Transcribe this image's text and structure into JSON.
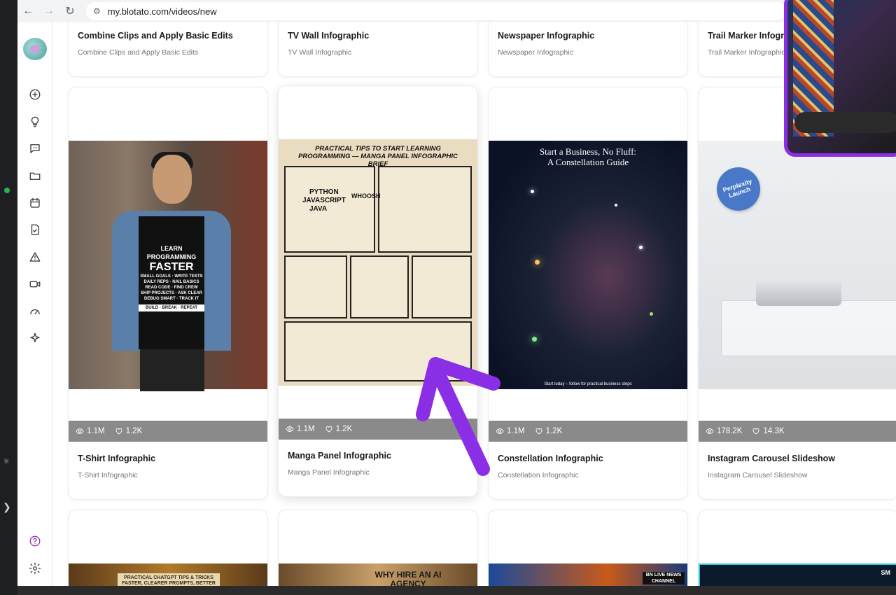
{
  "browser": {
    "url": "my.blotato.com/videos/new"
  },
  "cards_top": [
    {
      "title": "Combine Clips and Apply Basic Edits",
      "subtitle": "Combine Clips and Apply Basic Edits"
    },
    {
      "title": "TV Wall Infographic",
      "subtitle": "TV Wall Infographic"
    },
    {
      "title": "Newspaper Infographic",
      "subtitle": "Newspaper Infographic"
    },
    {
      "title": "Trail Marker Infogra",
      "subtitle": "Trail Marker Infographic"
    }
  ],
  "cards_main": [
    {
      "title": "T-Shirt Infographic",
      "subtitle": "T-Shirt Infographic",
      "views": "1.1M",
      "likes": "1.2K",
      "art": {
        "lines": [
          "LEARN PROGRAMMING",
          "FASTER",
          "SMALL GOALS",
          "WRITE TESTS",
          "DAILY REPS",
          "NAIL BASICS",
          "READ CODE",
          "FIND CREW",
          "SHIP PROJECTS",
          "ASK CLEAR",
          "DEBUG SMART",
          "TRACK IT",
          "BUILD · BREAK · REPEAT"
        ]
      }
    },
    {
      "title": "Manga Panel Infographic",
      "subtitle": "Manga Panel Infographic",
      "views": "1.1M",
      "likes": "1.2K",
      "art": {
        "heading": "PRACTICAL TIPS TO START LEARNING PROGRAMMING — MANGA PANEL INFOGRAPHIC BRIEF",
        "langs": [
          "PYTHON",
          "JAVASCRIPT",
          "JAVA"
        ],
        "sfx": "WHOOSH"
      }
    },
    {
      "title": "Constellation Infographic",
      "subtitle": "Constellation Infographic",
      "views": "1.1M",
      "likes": "1.2K",
      "art": {
        "heading_1": "Start a Business, No Fluff:",
        "heading_2": "A Constellation Guide",
        "footer": "Start today – follow for practical business steps"
      }
    },
    {
      "title": "Instagram Carousel Slideshow",
      "subtitle": "Instagram Carousel Slideshow",
      "views": "178.2K",
      "likes": "14.3K",
      "art": {
        "badge": "Perplexity Launch"
      }
    }
  ],
  "cards_bottom": [
    {
      "art_text": "PRACTICAL CHATGPT TIPS & TRICKS FASTER, CLEARER PROMPTS, BETTER OUTPUTS"
    },
    {
      "art_text": "WHY HIRE AN AI AGENCY"
    },
    {
      "art_text": "BN LIVE NEWS CHANNEL"
    },
    {
      "art_text": "SM"
    }
  ],
  "sidebar": {
    "icons": [
      "create-icon",
      "ideas-icon",
      "comments-icon",
      "folder-icon",
      "calendar-icon",
      "document-icon",
      "alert-icon",
      "video-icon",
      "analytics-icon",
      "ai-sparkle-icon",
      "help-icon",
      "settings-icon"
    ]
  },
  "colors": {
    "accent_purple": "#8b2fe6",
    "stats_bar": "#8a8a8a"
  }
}
